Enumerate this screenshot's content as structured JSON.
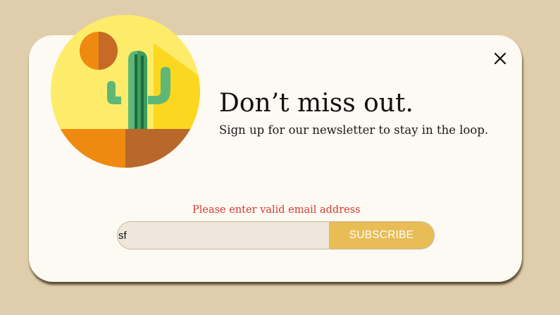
{
  "popup": {
    "headline": "Don’t miss out.",
    "subline": "Sign up for our newsletter to stay in the loop.",
    "error_message": "Please enter valid email address",
    "email_input": {
      "value": "sf"
    },
    "subscribe_label": "SUBSCRIBE",
    "close_icon": "close-icon",
    "illustration": "desert-cactus-illustration"
  },
  "colors": {
    "page_background": "#dfcdab",
    "card_background": "#fdf9f3",
    "error_text": "#d83a2e",
    "subscribe_button": "#e8bd56",
    "input_background": "#efe7dc"
  }
}
